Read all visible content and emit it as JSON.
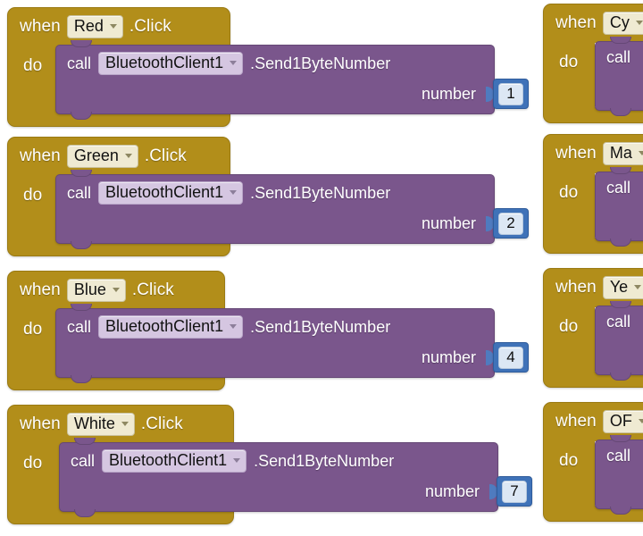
{
  "app": {
    "name": "MIT App Inventor Blocks Editor",
    "view": "blocks-canvas",
    "background_color": "#ffffff"
  },
  "palette": {
    "event_block_color": "#B28E1A",
    "call_block_color": "#7A568C",
    "number_block_color": "#3F72B8",
    "dropdown_field_color": "#EFEAD2",
    "component_dropdown_color": "#D5C6E1",
    "number_field_color": "#DCE7F4",
    "text_color": "#ffffff"
  },
  "labels": {
    "when": "when",
    "do": "do",
    "call": "call",
    "click_event": ".Click",
    "method": ".Send1ByteNumber",
    "param_number": "number",
    "component": "BluetoothClient1"
  },
  "blocks": [
    {
      "id": "when-red-click",
      "when": "when",
      "component": "Red",
      "event": ".Click",
      "do": "do",
      "call": "call",
      "target_component": "BluetoothClient1",
      "method": ".Send1ByteNumber",
      "param_label": "number",
      "param_value": "1"
    },
    {
      "id": "when-green-click",
      "when": "when",
      "component": "Green",
      "event": ".Click",
      "do": "do",
      "call": "call",
      "target_component": "BluetoothClient1",
      "method": ".Send1ByteNumber",
      "param_label": "number",
      "param_value": "2"
    },
    {
      "id": "when-blue-click",
      "when": "when",
      "component": "Blue",
      "event": ".Click",
      "do": "do",
      "call": "call",
      "target_component": "BluetoothClient1",
      "method": ".Send1ByteNumber",
      "param_label": "number",
      "param_value": "4"
    },
    {
      "id": "when-white-click",
      "when": "when",
      "component": "White",
      "event": ".Click",
      "do": "do",
      "call": "call",
      "target_component": "BluetoothClient1",
      "method": ".Send1ByteNumber",
      "param_label": "number",
      "param_value": "7"
    }
  ],
  "blocks_right": [
    {
      "id": "when-cyan-click",
      "when": "when",
      "component": "Cy",
      "do": "do",
      "call": "call"
    },
    {
      "id": "when-magenta-click",
      "when": "when",
      "component": "Ma",
      "do": "do",
      "call": "call"
    },
    {
      "id": "when-yellow-click",
      "when": "when",
      "component": "Ye",
      "do": "do",
      "call": "call"
    },
    {
      "id": "when-off-click",
      "when": "when",
      "component": "OF",
      "do": "do",
      "call": "call"
    }
  ]
}
